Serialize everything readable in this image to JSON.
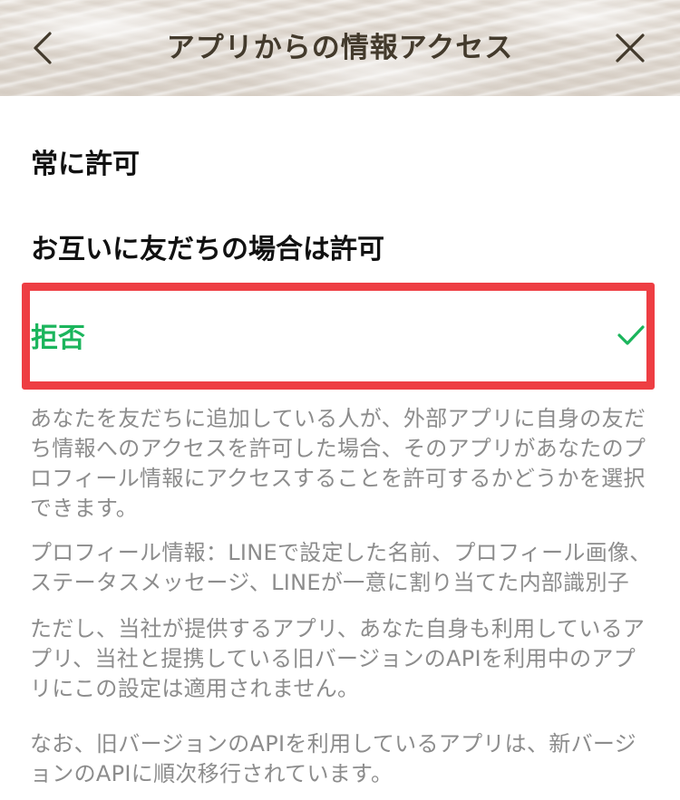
{
  "header": {
    "title": "アプリからの情報アクセス",
    "back_icon": "chevron-left-icon",
    "close_icon": "close-icon",
    "icon_color": "#433a2c"
  },
  "options": [
    {
      "label": "常に許可",
      "selected": false
    },
    {
      "label": "お互いに友だちの場合は許可",
      "selected": false
    },
    {
      "label": "拒否",
      "selected": true,
      "check_icon": "checkmark-icon"
    }
  ],
  "colors": {
    "selected_text": "#1bb55c",
    "highlight_border": "#ee3e43",
    "description_text": "#8c8c8c"
  },
  "description": [
    "あなたを友だちに追加している人が、外部アプリに自身の友だち情報へのアクセスを許可した場合、そのアプリがあなたのプロフィール情報にアクセスすることを許可するかどうかを選択できます。",
    "プロフィール情報：LINEで設定した名前、プロフィール画像、ステータスメッセージ、LINEが一意に割り当てた内部識別子",
    "ただし、当社が提供するアプリ、あなた自身も利用しているアプリ、当社と提携している旧バージョンのAPIを利用中のアプリにこの設定は適用されません。",
    "なお、旧バージョンのAPIを利用しているアプリは、新バージョンのAPIに順次移行されています。"
  ]
}
